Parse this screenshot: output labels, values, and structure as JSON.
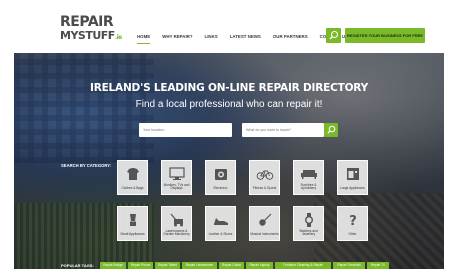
{
  "brand": {
    "line1": "REPAIR",
    "line2": "MYSTUFF",
    "suffix": ".ie",
    "accent": "#7ab928"
  },
  "nav": {
    "items": [
      {
        "label": "HOME",
        "active": true
      },
      {
        "label": "WHY REPAIR?",
        "active": false
      },
      {
        "label": "LINKS",
        "active": false
      },
      {
        "label": "LATEST NEWS",
        "active": false
      },
      {
        "label": "OUR PARTNERS",
        "active": false
      },
      {
        "label": "CONTACT US",
        "active": false
      }
    ],
    "search_icon": "search-icon",
    "register_label": "REGISTER YOUR BUSINESS FOR FREE"
  },
  "hero": {
    "title": "IRELAND'S LEADING ON-LINE REPAIR DIRECTORY",
    "subtitle": "Find a local professional who can repair it!",
    "location_placeholder": "Your location...",
    "what_placeholder": "What do you want to repair?",
    "search_icon": "search-icon"
  },
  "categories": {
    "label": "SEARCH BY CATEGORY:",
    "items": [
      {
        "label": "Clothes & Bags",
        "icon": "clothes-icon"
      },
      {
        "label": "Monitors, TVs and Displays",
        "icon": "monitor-icon"
      },
      {
        "label": "Electronic",
        "icon": "electronic-icon"
      },
      {
        "label": "Fitness & Sports",
        "icon": "bicycle-icon"
      },
      {
        "label": "Furniture & Upholstery",
        "icon": "sofa-icon"
      },
      {
        "label": "Large Appliances",
        "icon": "appliance-icon"
      },
      {
        "label": "Small Appliances",
        "icon": "blender-icon"
      },
      {
        "label": "Lawnmowers & Garden Machinery",
        "icon": "lawnmower-icon"
      },
      {
        "label": "Leather & Shoes",
        "icon": "shoe-icon"
      },
      {
        "label": "Musical Instruments",
        "icon": "guitar-icon"
      },
      {
        "label": "Watches and Jewellery",
        "icon": "watch-icon"
      },
      {
        "label": "Other",
        "icon": "question-icon"
      }
    ]
  },
  "tags": {
    "label": "POPULAR TAGS:",
    "items": [
      "Repair Bridge",
      "Repair Phone",
      "Repair Tablet",
      "Repair Lawnmower",
      "Repair Guitar",
      "Repair Laptop",
      "Furniture Cleaning & Repair",
      "Repair Treadmill",
      "Repair TV"
    ]
  }
}
